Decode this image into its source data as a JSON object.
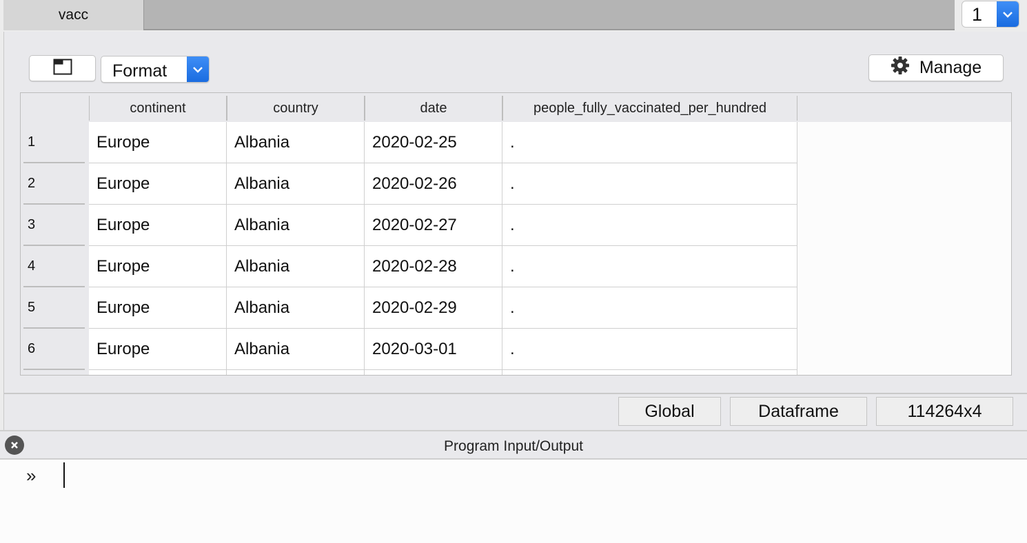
{
  "tabs": [
    {
      "label": "vacc"
    }
  ],
  "pager": {
    "value": "1"
  },
  "toolbar": {
    "format_label": "Format",
    "manage_label": "Manage"
  },
  "table": {
    "columns": [
      "continent",
      "country",
      "date",
      "people_fully_vaccinated_per_hundred"
    ],
    "rows": [
      {
        "num": "1",
        "cells": [
          "Europe",
          "Albania",
          "2020-02-25",
          "."
        ]
      },
      {
        "num": "2",
        "cells": [
          "Europe",
          "Albania",
          "2020-02-26",
          "."
        ]
      },
      {
        "num": "3",
        "cells": [
          "Europe",
          "Albania",
          "2020-02-27",
          "."
        ]
      },
      {
        "num": "4",
        "cells": [
          "Europe",
          "Albania",
          "2020-02-28",
          "."
        ]
      },
      {
        "num": "5",
        "cells": [
          "Europe",
          "Albania",
          "2020-02-29",
          "."
        ]
      },
      {
        "num": "6",
        "cells": [
          "Europe",
          "Albania",
          "2020-03-01",
          "."
        ]
      }
    ]
  },
  "status": {
    "scope": "Global",
    "type": "Dataframe",
    "dims": "114264x4"
  },
  "io_panel": {
    "title": "Program Input/Output",
    "prompt": "»"
  },
  "colors": {
    "accent_blue": "#1a6ce0",
    "panel_bg": "#e9e9ec",
    "tabstrip_bg": "#b4b4b4"
  }
}
